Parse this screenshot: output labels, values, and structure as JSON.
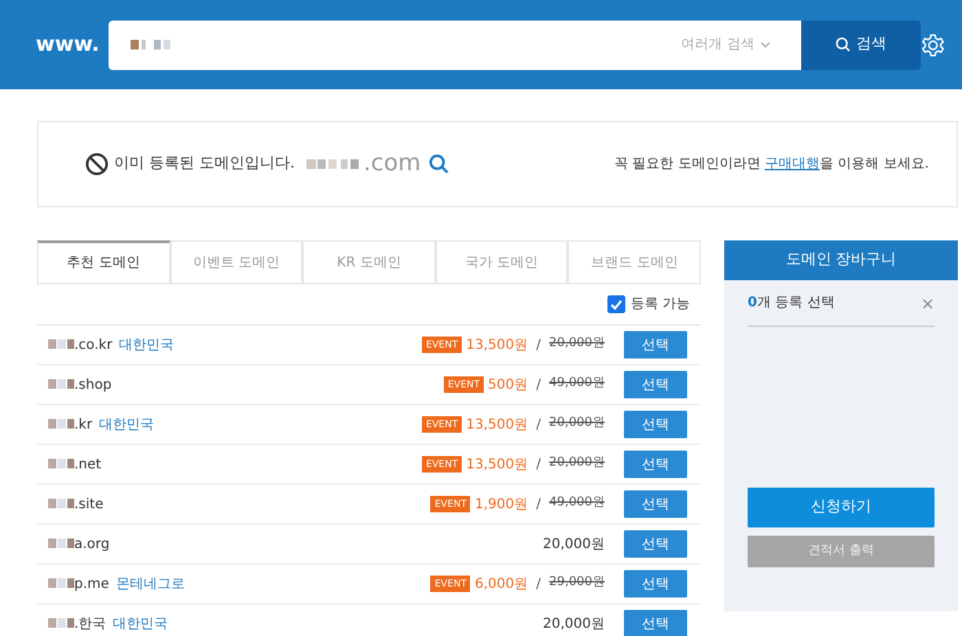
{
  "header": {
    "prefix": "www.",
    "search_mode": "여러개 검색",
    "search_button": "검색"
  },
  "notice": {
    "message": "이미 등록된 도메인입니다.",
    "domain_suffix": ".com",
    "hint_before": "꼭 필요한 도메인이라면 ",
    "hint_link": "구매대행",
    "hint_after": "을 이용해 보세요."
  },
  "tabs": [
    {
      "label": "추천 도메인",
      "selected": true
    },
    {
      "label": "이벤트 도메인",
      "selected": false
    },
    {
      "label": "KR 도메인",
      "selected": false
    },
    {
      "label": "국가 도메인",
      "selected": false
    },
    {
      "label": "브랜드 도메인",
      "selected": false
    }
  ],
  "filter": {
    "label": "등록 가능",
    "checked": true
  },
  "rows": [
    {
      "kind": "event",
      "domain": ".co.kr",
      "country": "대한민국",
      "badge": "EVENT",
      "price": "13,500원",
      "sep": "/",
      "original": "20,000원",
      "button": "선택"
    },
    {
      "kind": "event",
      "domain": ".shop",
      "badge": "EVENT",
      "price": "500원",
      "sep": "/",
      "original": "49,000원",
      "button": "선택"
    },
    {
      "kind": "event",
      "domain": ".kr",
      "country": "대한민국",
      "badge": "EVENT",
      "price": "13,500원",
      "sep": "/",
      "original": "20,000원",
      "button": "선택"
    },
    {
      "kind": "event",
      "domain": ".net",
      "badge": "EVENT",
      "price": "13,500원",
      "sep": "/",
      "original": "20,000원",
      "button": "선택"
    },
    {
      "kind": "event",
      "domain": ".site",
      "badge": "EVENT",
      "price": "1,900원",
      "sep": "/",
      "original": "49,000원",
      "button": "선택"
    },
    {
      "kind": "regular",
      "domain": "a.org",
      "price": "20,000원",
      "button": "선택"
    },
    {
      "kind": "event",
      "domain": "p.me",
      "country": "몬테네그로",
      "badge": "EVENT",
      "price": "6,000원",
      "sep": "/",
      "original": "29,000원",
      "button": "선택"
    },
    {
      "kind": "regular",
      "domain": ".한국",
      "country": "대한민국",
      "price": "20,000원",
      "button": "선택"
    }
  ],
  "cart": {
    "title": "도메인 장바구니",
    "count": "0",
    "count_label": "개 등록 선택",
    "close": "×",
    "apply": "신청하기",
    "quote": "견적서 출력"
  }
}
